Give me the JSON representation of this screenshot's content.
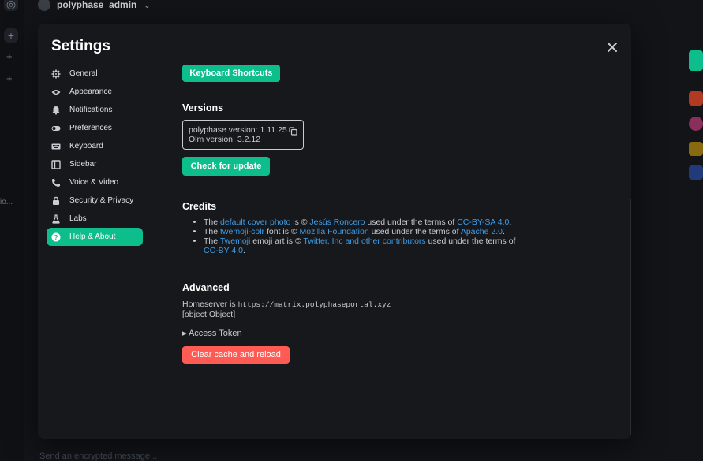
{
  "background": {
    "header_user": "polyphase_admin",
    "left_truncated": "io...",
    "bottom_text": "Send an encrypted message..."
  },
  "modal": {
    "title": "Settings",
    "close_label": "close-icon"
  },
  "nav": {
    "items": [
      {
        "label": "General",
        "icon": "gear-icon"
      },
      {
        "label": "Appearance",
        "icon": "eye-icon"
      },
      {
        "label": "Notifications",
        "icon": "bell-icon"
      },
      {
        "label": "Preferences",
        "icon": "toggle-icon"
      },
      {
        "label": "Keyboard",
        "icon": "keyboard-icon"
      },
      {
        "label": "Sidebar",
        "icon": "sidebar-icon"
      },
      {
        "label": "Voice & Video",
        "icon": "phone-icon"
      },
      {
        "label": "Security & Privacy",
        "icon": "lock-icon"
      },
      {
        "label": "Labs",
        "icon": "flask-icon"
      },
      {
        "label": "Help & About",
        "icon": "help-icon"
      }
    ],
    "active_index": 9
  },
  "content": {
    "keyboard_shortcuts_label": "Keyboard Shortcuts",
    "versions": {
      "title": "Versions",
      "app_version": "polyphase version: 1.11.25",
      "olm_version": "Olm version: 3.2.12",
      "check_update_label": "Check for update"
    },
    "credits": {
      "title": "Credits",
      "items": [
        {
          "pre": "The ",
          "link1": "default cover photo",
          "mid1": " is © ",
          "link2": "Jesús Roncero",
          "mid2": " used under the terms of ",
          "link3": "CC-BY-SA 4.0",
          "post": "."
        },
        {
          "pre": "The ",
          "link1": "twemoji-colr",
          "mid1": " font is © ",
          "link2": "Mozilla Foundation",
          "mid2": " used under the terms of ",
          "link3": "Apache 2.0",
          "post": "."
        },
        {
          "pre": "The ",
          "link1": "Twemoji",
          "mid1": " emoji art is © ",
          "link2": "Twitter, Inc and other contributors",
          "mid2": " used under the terms of ",
          "link3": "CC-BY 4.0",
          "post": "."
        }
      ]
    },
    "advanced": {
      "title": "Advanced",
      "homeserver_prefix": "Homeserver is ",
      "homeserver_url": "https://matrix.polyphaseportal.xyz",
      "object_text": "[object Object]",
      "access_token_label": "▸ Access Token",
      "clear_cache_label": "Clear cache and reload"
    }
  },
  "colors": {
    "accent": "#0dbd8b",
    "danger": "#ff5b55",
    "link": "#3d9de9",
    "modal_bg": "#16181c"
  }
}
